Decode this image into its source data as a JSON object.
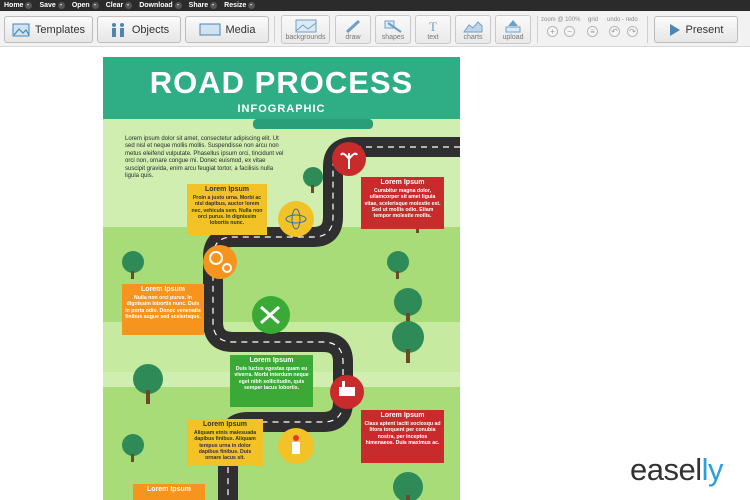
{
  "menu": {
    "items": [
      {
        "label": "Home"
      },
      {
        "label": "Save"
      },
      {
        "label": "Open"
      },
      {
        "label": "Clear"
      },
      {
        "label": "Download"
      },
      {
        "label": "Share"
      },
      {
        "label": "Resize"
      }
    ]
  },
  "toolbar": {
    "templates_label": "Templates",
    "objects_label": "Objects",
    "media_label": "Media",
    "tools": [
      {
        "label": "backgrounds",
        "icon": "backgrounds-icon"
      },
      {
        "label": "draw",
        "icon": "pencil-icon"
      },
      {
        "label": "shapes",
        "icon": "shapes-icon"
      },
      {
        "label": "text",
        "icon": "text-icon"
      },
      {
        "label": "charts",
        "icon": "chart-icon"
      },
      {
        "label": "upload",
        "icon": "upload-icon"
      }
    ],
    "zoom_label": "zoom @ 100%",
    "grid_label": "grid",
    "undo_redo_label": "undo - redo",
    "present_label": "Present"
  },
  "infographic": {
    "title": "ROAD PROCESS",
    "subtitle": "INFOGRAPHIC",
    "intro": "Lorem ipsum dolor sit amet, consectetur adipiscing elit. Ut sed nisl et neque mollis mollis. Suspendisse non arcu non metus eleifend vulputate. Phasellus ipsum orci, tincidunt vel orci non, ornare congue mi. Donec euismod, ex vitae suscipit gravida, enim arcu feugiat tortor, a facilisis nulla ligula quis.",
    "steps": [
      {
        "heading": "Lorem Ipsum",
        "text": "Proin a justo urna. Morbi ac nisl dapibus, auctor lorem nec, vehicula sem. Nulla non orci purus. In dignissim lobortis nunc."
      },
      {
        "heading": "Lorem Ipsum",
        "text": "Curabitur magna dolor, ullamcorper sit amet ligula vitae, scelerisque molestie est. Sed ut mollis odio. Etiam tempor molestie mollis."
      },
      {
        "heading": "Lorem Ipsum",
        "text": "Nulla non orci purus. In dignissim lobortis nunc. Duis in porta odio. Donec venenatis finibus augue sed scelerisque."
      },
      {
        "heading": "Lorem Ipsum",
        "text": "Duis luctus egestas quam eu viverra. Morbi interdum neque eget nibh sollicitudin, quis semper lacus lobortis."
      },
      {
        "heading": "Lorem Ipsum",
        "text": "Class aptent taciti sociosqu ad litora torquent per conubia nostra, per inceptos himenaeos. Duis maximus ac."
      },
      {
        "heading": "Lorem Ipsum",
        "text": "Aliquam etnis malesuada dapibus finibus. Aliquam tempus urna in dolor dapibus finibus. Duis ornare lacus sit."
      },
      {
        "heading": "Lorem Ipsum",
        "text": ""
      }
    ]
  },
  "brand": {
    "logo_main": "easel",
    "logo_accent": "ly"
  },
  "colors": {
    "header_teal": "#2fae86",
    "road": "#2f2f2f",
    "grass_light": "#cfeeaf",
    "grass_dark": "#8fcf5e",
    "box_yellow": "#f2c227",
    "box_red": "#c82b2b",
    "box_orange": "#f7941d",
    "box_green": "#3aa935",
    "logo_accent": "#2a9fd8"
  }
}
